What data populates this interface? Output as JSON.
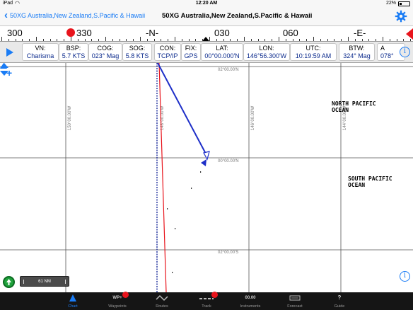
{
  "status_bar": {
    "device": "iPad",
    "time": "12:20 AM",
    "battery": "22%"
  },
  "nav": {
    "back_label": "50XG Australia,New Zealand,S.Pacific & Hawaii",
    "title": "50XG Australia,New Zealand,S.Pacific & Hawaii"
  },
  "compass": {
    "labels": [
      "300",
      "330",
      "-N-",
      "030",
      "060",
      "-E-"
    ]
  },
  "instruments": [
    {
      "key": "VN:",
      "value": "Charisma"
    },
    {
      "key": "BSP:",
      "value": "5.7 KTS"
    },
    {
      "key": "COG:",
      "value": "023° Mag"
    },
    {
      "key": "SOG:",
      "value": "5.8 KTS"
    },
    {
      "key": "CON:",
      "value": "TCP/IP"
    },
    {
      "key": "FIX:",
      "value": "GPS"
    },
    {
      "key": "LAT:",
      "value": "00°00.000'N"
    },
    {
      "key": "LON:",
      "value": "146°56.300'W"
    },
    {
      "key": "UTC:",
      "value": "10:19:59 AM"
    },
    {
      "key": "BTW:",
      "value": "324° Mag"
    },
    {
      "key": "A",
      "value": "078° "
    }
  ],
  "map": {
    "lat_labels": [
      "02°00.00'N",
      "00°00.00'N",
      "02°00.00'S"
    ],
    "lon_labels": [
      "150°00.00'W",
      "148°00.00'W",
      "146°00.00'W",
      "144°00.00'W"
    ],
    "ocean_labels": [
      {
        "line1": "NORTH PACIFIC",
        "line2": "OCEAN"
      },
      {
        "line1": "SOUTH PACIFIC",
        "line2": "OCEAN"
      }
    ],
    "scale": "61 NM",
    "zoom_in": "+"
  },
  "tabs": [
    {
      "label": "Chart",
      "icon": "chart-icon",
      "glyph": "▲"
    },
    {
      "label": "Waypoints",
      "icon": "waypoints-icon",
      "glyph": "WP+"
    },
    {
      "label": "Routes",
      "icon": "routes-icon",
      "glyph": ""
    },
    {
      "label": "Track",
      "icon": "track-icon",
      "glyph": ""
    },
    {
      "label": "Instruments",
      "icon": "instruments-icon",
      "glyph": "00.00"
    },
    {
      "label": "Forecast",
      "icon": "forecast-icon",
      "glyph": ""
    },
    {
      "label": "Guide",
      "icon": "guide-icon",
      "glyph": "?"
    }
  ],
  "colors": {
    "accent": "#1a7cf5",
    "alert": "#e8141c",
    "vector": "#1e2fc8",
    "track": "#e8141c",
    "heading": "#1a2a9a"
  }
}
